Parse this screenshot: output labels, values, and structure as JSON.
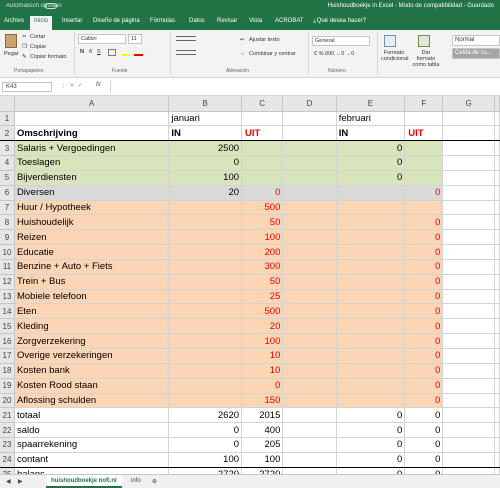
{
  "titlebar": {
    "autosave": "Automatisch opslaan",
    "title": "Huishoudboekje in Excel  -  Modo de compatibilidad  -  Guardado"
  },
  "tabs": [
    "Archivo",
    "Inicio",
    "Insertar",
    "Diseño de página",
    "Fórmulas",
    "Datos",
    "Revisar",
    "Vista",
    "ACROBAT",
    "¿Qué desea hacer?"
  ],
  "ribbon": {
    "paste": "Pegar",
    "cut": "Cortar",
    "copy": "Copiar",
    "format_painter": "Copiar formato",
    "font_name": "Calibri",
    "font_size": "11",
    "bold": "N",
    "italic": "K",
    "underline": "S",
    "wrap": "Ajustar texto",
    "merge": "Combinar y centrar",
    "number_format": "General",
    "cond_format": "Formato condicional",
    "format_table": "Dar formato como tabla",
    "style_normal": "Normal",
    "style_check": "Celda de co...",
    "groups": [
      "Portapapeles",
      "Fuente",
      "Alineación",
      "Número"
    ]
  },
  "formula": {
    "namebox": "K43",
    "fx": "fx",
    "value": ""
  },
  "columns": [
    "A",
    "B",
    "C",
    "D",
    "E",
    "F",
    "G"
  ],
  "rows": [
    {
      "n": "1",
      "style": "",
      "cells": [
        "",
        "januari",
        "",
        "",
        "februari",
        "",
        ""
      ]
    },
    {
      "n": "2",
      "style": "",
      "cells": [
        "Omschrijving",
        "IN",
        "UIT",
        "",
        "IN",
        "UIT",
        ""
      ]
    },
    {
      "n": "3",
      "style": "green",
      "cells": [
        "Salaris + Vergoedingen",
        "2500",
        "",
        "",
        "0",
        "",
        ""
      ]
    },
    {
      "n": "4",
      "style": "green",
      "cells": [
        "Toeslagen",
        "0",
        "",
        "",
        "0",
        "",
        ""
      ]
    },
    {
      "n": "5",
      "style": "green",
      "cells": [
        "Bijverdiensten",
        "100",
        "",
        "",
        "0",
        "",
        ""
      ]
    },
    {
      "n": "6",
      "style": "grey",
      "cells": [
        "Diversen",
        "20",
        "0",
        "",
        "",
        "0",
        ""
      ]
    },
    {
      "n": "7",
      "style": "peach",
      "cells": [
        "Huur / Hypotheek",
        "",
        "500",
        "",
        "",
        "",
        ""
      ]
    },
    {
      "n": "8",
      "style": "peach",
      "cells": [
        "Huishoudelijk",
        "",
        "50",
        "",
        "",
        "0",
        ""
      ]
    },
    {
      "n": "9",
      "style": "peach",
      "cells": [
        "Reizen",
        "",
        "100",
        "",
        "",
        "0",
        ""
      ]
    },
    {
      "n": "10",
      "style": "peach",
      "cells": [
        "Educatie",
        "",
        "200",
        "",
        "",
        "0",
        ""
      ]
    },
    {
      "n": "11",
      "style": "peach",
      "cells": [
        "Benzine + Auto + Fiets",
        "",
        "300",
        "",
        "",
        "0",
        ""
      ]
    },
    {
      "n": "12",
      "style": "peach",
      "cells": [
        "Trein + Bus",
        "",
        "50",
        "",
        "",
        "0",
        ""
      ]
    },
    {
      "n": "13",
      "style": "peach",
      "cells": [
        "Mobiele telefoon",
        "",
        "25",
        "",
        "",
        "0",
        ""
      ]
    },
    {
      "n": "14",
      "style": "peach",
      "cells": [
        "Eten",
        "",
        "500",
        "",
        "",
        "0",
        ""
      ]
    },
    {
      "n": "15",
      "style": "peach",
      "cells": [
        "Kleding",
        "",
        "20",
        "",
        "",
        "0",
        ""
      ]
    },
    {
      "n": "16",
      "style": "peach",
      "cells": [
        "Zorgverzekering",
        "",
        "100",
        "",
        "",
        "0",
        ""
      ]
    },
    {
      "n": "17",
      "style": "peach",
      "cells": [
        "Overige verzekeringen",
        "",
        "10",
        "",
        "",
        "0",
        ""
      ]
    },
    {
      "n": "18",
      "style": "peach",
      "cells": [
        "Kosten bank",
        "",
        "10",
        "",
        "",
        "0",
        ""
      ]
    },
    {
      "n": "19",
      "style": "peach",
      "cells": [
        "Kosten Rood staan",
        "",
        "0",
        "",
        "",
        "0",
        ""
      ]
    },
    {
      "n": "20",
      "style": "peach",
      "cells": [
        "Aflossing schulden",
        "",
        "150",
        "",
        "",
        "0",
        ""
      ]
    },
    {
      "n": "21",
      "style": "",
      "cells": [
        "totaal",
        "2620",
        "2015",
        "",
        "0",
        "0",
        ""
      ]
    },
    {
      "n": "22",
      "style": "",
      "cells": [
        "saldo",
        "0",
        "400",
        "",
        "0",
        "0",
        ""
      ]
    },
    {
      "n": "23",
      "style": "",
      "cells": [
        "spaarrekening",
        "0",
        "205",
        "",
        "0",
        "0",
        ""
      ]
    },
    {
      "n": "24",
      "style": "",
      "cells": [
        "contant",
        "100",
        "100",
        "",
        "0",
        "0",
        ""
      ]
    },
    {
      "n": "25",
      "style": "",
      "cells": [
        "balans",
        "2720",
        "2720",
        "",
        "0",
        "0",
        ""
      ]
    },
    {
      "n": "26",
      "style": "",
      "cells": [
        "",
        "",
        "0",
        "",
        "",
        "0",
        ""
      ]
    }
  ],
  "sheets": [
    "huishoudboekje nofi.nl",
    "info"
  ],
  "colors": {
    "excel_green": "#217346",
    "income_fill": "#d7e4bc",
    "misc_fill": "#d9d9d9",
    "expense_fill": "#fcd5b4",
    "uit_red": "#ee0000"
  }
}
